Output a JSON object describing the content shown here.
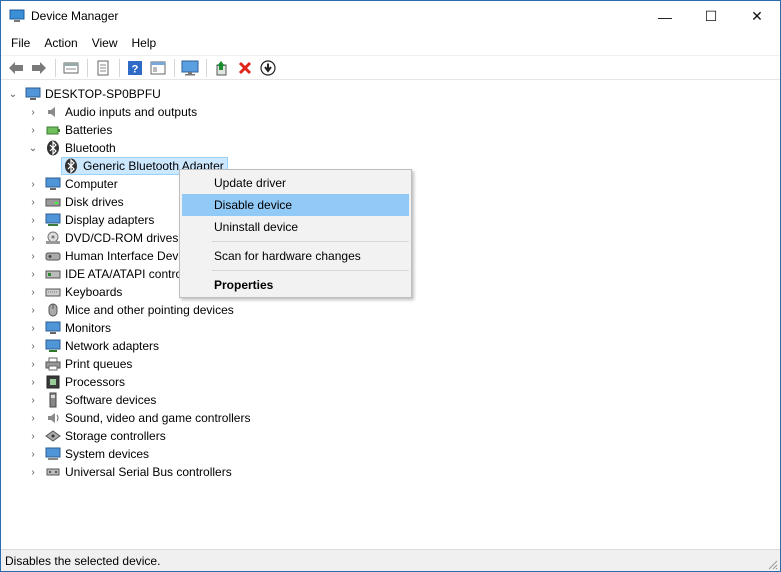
{
  "window": {
    "title": "Device Manager",
    "controls": {
      "minimize": "—",
      "maximize": "☐",
      "close": "✕"
    }
  },
  "menu": [
    "File",
    "Action",
    "View",
    "Help"
  ],
  "toolbar": {
    "buttons": [
      "back-icon",
      "forward-icon",
      "properties-page-icon",
      "properties-icon",
      "help-icon",
      "view-icon",
      "monitor-icon",
      "update-driver-icon",
      "uninstall-icon",
      "disable-icon"
    ],
    "colors": {
      "uninstall": "#e0261b",
      "update": "#1a8c2f"
    }
  },
  "tree": {
    "root": "DESKTOP-SP0BPFU",
    "categories": [
      {
        "label": "Audio inputs and outputs",
        "icon": "speaker-icon",
        "expanded": false
      },
      {
        "label": "Batteries",
        "icon": "battery-icon",
        "expanded": false
      },
      {
        "label": "Bluetooth",
        "icon": "bluetooth-icon",
        "expanded": true,
        "children": [
          {
            "label": "Generic Bluetooth Adapter",
            "icon": "bluetooth-icon",
            "selected": true
          }
        ]
      },
      {
        "label": "Computer",
        "icon": "computer-icon",
        "expanded": false
      },
      {
        "label": "Disk drives",
        "icon": "disk-drive-icon",
        "expanded": false
      },
      {
        "label": "Display adapters",
        "icon": "display-adapter-icon",
        "expanded": false
      },
      {
        "label": "DVD/CD-ROM drives",
        "icon": "dvd-icon",
        "expanded": false
      },
      {
        "label": "Human Interface Devices",
        "icon": "hid-icon",
        "expanded": false
      },
      {
        "label": "IDE ATA/ATAPI controllers",
        "icon": "ide-icon",
        "expanded": false
      },
      {
        "label": "Keyboards",
        "icon": "keyboard-icon",
        "expanded": false
      },
      {
        "label": "Mice and other pointing devices",
        "icon": "mouse-icon",
        "expanded": false
      },
      {
        "label": "Monitors",
        "icon": "monitor-icon",
        "expanded": false
      },
      {
        "label": "Network adapters",
        "icon": "network-icon",
        "expanded": false
      },
      {
        "label": "Print queues",
        "icon": "printer-icon",
        "expanded": false
      },
      {
        "label": "Processors",
        "icon": "processor-icon",
        "expanded": false
      },
      {
        "label": "Software devices",
        "icon": "software-device-icon",
        "expanded": false
      },
      {
        "label": "Sound, video and game controllers",
        "icon": "sound-icon",
        "expanded": false
      },
      {
        "label": "Storage controllers",
        "icon": "storage-icon",
        "expanded": false
      },
      {
        "label": "System devices",
        "icon": "system-icon",
        "expanded": false
      },
      {
        "label": "Universal Serial Bus controllers",
        "icon": "usb-icon",
        "expanded": false
      }
    ]
  },
  "context_menu": {
    "items": [
      "Update driver",
      "Disable device",
      "Uninstall device",
      "Scan for hardware changes",
      "Properties"
    ],
    "highlighted": "Disable device",
    "highlight_color": "#91c9f7"
  },
  "status": {
    "text": "Disables the selected device."
  }
}
